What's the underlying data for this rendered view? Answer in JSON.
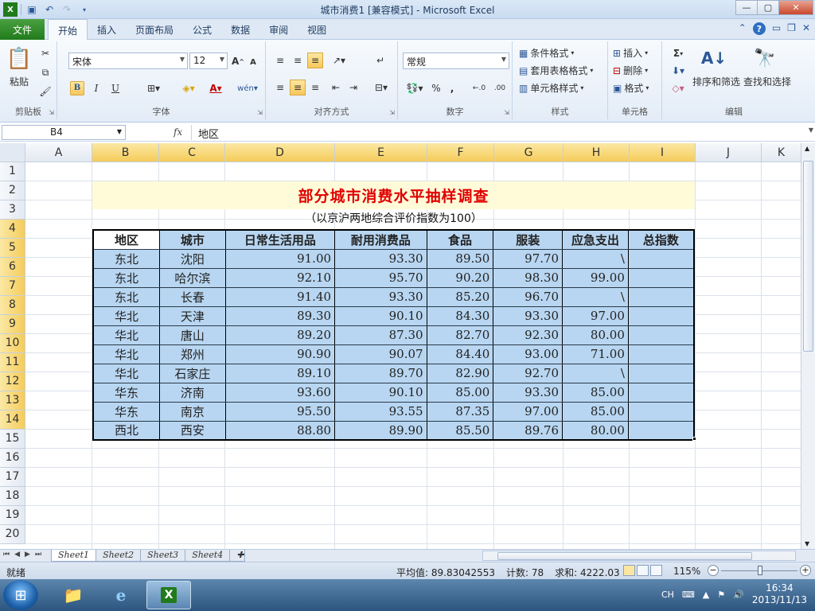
{
  "window": {
    "title": "城市消费1 [兼容模式] - Microsoft Excel",
    "minimize": "—",
    "maximize": "▢",
    "close": "✕"
  },
  "qat": {
    "save_icon": "save-icon",
    "undo_icon": "undo-icon",
    "redo_icon": "redo-icon"
  },
  "ribbon_tabs": {
    "file": "文件",
    "tabs": [
      "开始",
      "插入",
      "页面布局",
      "公式",
      "数据",
      "审阅",
      "视图"
    ],
    "active": "开始"
  },
  "ribbon": {
    "clipboard": {
      "paste": "粘贴",
      "label": "剪贴板"
    },
    "font": {
      "name": "宋体",
      "size": "12",
      "grow": "A",
      "shrink": "A",
      "bold": "B",
      "italic": "I",
      "underline": "U",
      "wen": "wén",
      "label": "字体"
    },
    "alignment": {
      "label": "对齐方式"
    },
    "number": {
      "format": "常规",
      "percent": "%",
      "comma": ",",
      "inc": "←.0",
      "dec": ".00",
      "label": "数字"
    },
    "styles": {
      "conditional": "条件格式",
      "table": "套用表格格式",
      "cell": "单元格样式",
      "label": "样式"
    },
    "cells": {
      "insert": "插入",
      "delete": "删除",
      "format": "格式",
      "label": "单元格"
    },
    "editing": {
      "sum": "Σ",
      "sort": "排序和筛选",
      "find": "查找和选择",
      "label": "编辑"
    }
  },
  "formula_bar": {
    "name_box": "B4",
    "fx": "fx",
    "content": "地区"
  },
  "grid": {
    "columns": [
      "A",
      "B",
      "C",
      "D",
      "E",
      "F",
      "G",
      "H",
      "I",
      "J",
      "K"
    ],
    "rows": [
      "1",
      "2",
      "3",
      "4",
      "5",
      "6",
      "7",
      "8",
      "9",
      "10",
      "11",
      "12",
      "13",
      "14",
      "15",
      "16",
      "17",
      "18",
      "19",
      "20"
    ],
    "selected_columns": [
      "B",
      "C",
      "D",
      "E",
      "F",
      "G",
      "H",
      "I"
    ],
    "selected_rows": [
      "4",
      "5",
      "6",
      "7",
      "8",
      "9",
      "10",
      "11",
      "12",
      "13",
      "14"
    ]
  },
  "sheet_content": {
    "title": "部分城市消费水平抽样调查",
    "subtitle": "（以京沪两地综合评价指数为100）",
    "headers": [
      "地区",
      "城市",
      "日常生活用品",
      "耐用消费品",
      "食品",
      "服装",
      "应急支出",
      "总指数"
    ],
    "rows": [
      [
        "东北",
        "沈阳",
        "91.00",
        "93.30",
        "89.50",
        "97.70",
        "\\",
        ""
      ],
      [
        "东北",
        "哈尔滨",
        "92.10",
        "95.70",
        "90.20",
        "98.30",
        "99.00",
        ""
      ],
      [
        "东北",
        "长春",
        "91.40",
        "93.30",
        "85.20",
        "96.70",
        "\\",
        ""
      ],
      [
        "华北",
        "天津",
        "89.30",
        "90.10",
        "84.30",
        "93.30",
        "97.00",
        ""
      ],
      [
        "华北",
        "唐山",
        "89.20",
        "87.30",
        "82.70",
        "92.30",
        "80.00",
        ""
      ],
      [
        "华北",
        "郑州",
        "90.90",
        "90.07",
        "84.40",
        "93.00",
        "71.00",
        ""
      ],
      [
        "华北",
        "石家庄",
        "89.10",
        "89.70",
        "82.90",
        "92.70",
        "\\",
        ""
      ],
      [
        "华东",
        "济南",
        "93.60",
        "90.10",
        "85.00",
        "93.30",
        "85.00",
        ""
      ],
      [
        "华东",
        "南京",
        "95.50",
        "93.55",
        "87.35",
        "97.00",
        "85.00",
        ""
      ],
      [
        "西北",
        "西安",
        "88.80",
        "89.90",
        "85.50",
        "89.76",
        "80.00",
        ""
      ]
    ]
  },
  "sheet_tabs": {
    "tabs": [
      "Sheet1",
      "Sheet2",
      "Sheet3",
      "Sheet4"
    ],
    "active": "Sheet1"
  },
  "status_bar": {
    "mode": "就绪",
    "average": "平均值: 89.83042553",
    "count": "计数: 78",
    "sum": "求和: 4222.03",
    "zoom": "115%"
  },
  "taskbar": {
    "lang": "CH",
    "time": "16:34",
    "date": "2013/11/13"
  },
  "colors": {
    "title_red": "#e00000",
    "table_blue": "#b8d6f1",
    "title_band": "#fffbd9",
    "header_selected": "#f5cc5a",
    "file_tab_green": "#217b1c"
  }
}
